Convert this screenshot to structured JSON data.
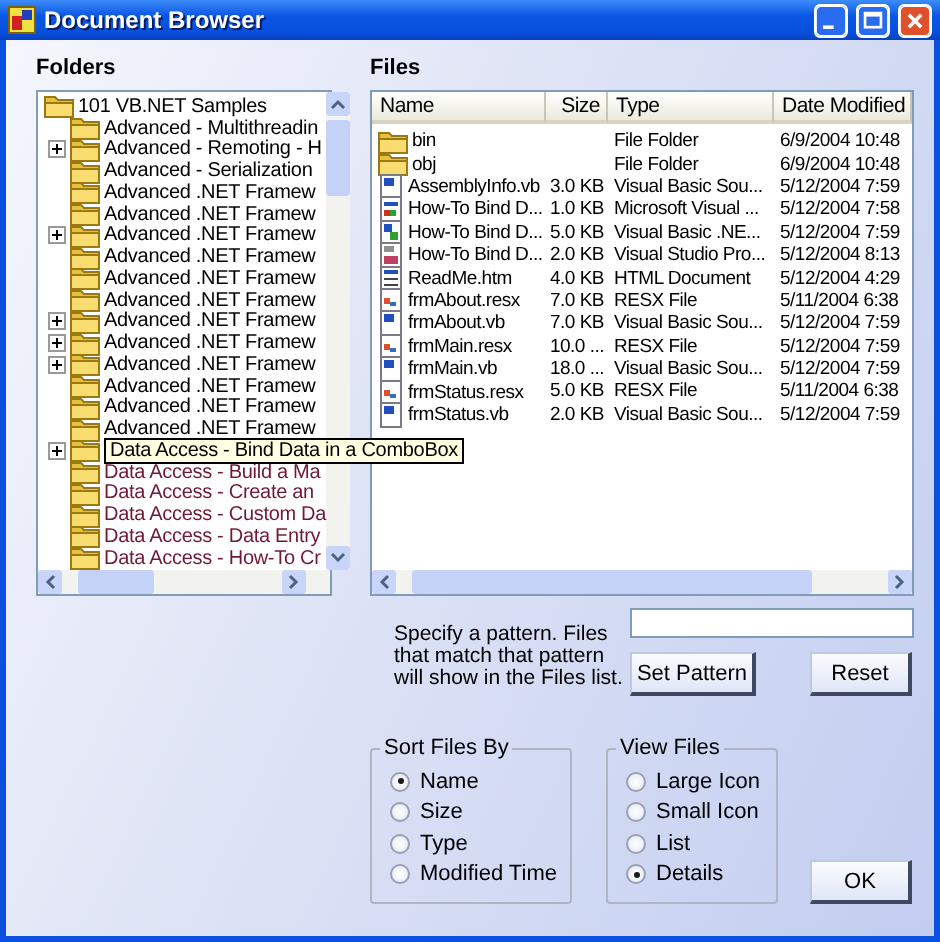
{
  "window": {
    "title": "Document Browser"
  },
  "folders": {
    "label": "Folders",
    "tree": {
      "label": "101 VB.NET Samples",
      "children": [
        {
          "label": "Advanced - Multithreadin",
          "expandable": false,
          "color": "#000000"
        },
        {
          "label": "Advanced - Remoting - H",
          "expandable": true,
          "color": "#000000"
        },
        {
          "label": "Advanced - Serialization",
          "expandable": false,
          "color": "#000000"
        },
        {
          "label": "Advanced .NET Framew",
          "expandable": false,
          "color": "#000000"
        },
        {
          "label": "Advanced .NET Framew",
          "expandable": false,
          "color": "#000000"
        },
        {
          "label": "Advanced .NET Framew",
          "expandable": true,
          "color": "#000000"
        },
        {
          "label": "Advanced .NET Framew",
          "expandable": false,
          "color": "#000000"
        },
        {
          "label": "Advanced .NET Framew",
          "expandable": false,
          "color": "#000000"
        },
        {
          "label": "Advanced .NET Framew",
          "expandable": false,
          "color": "#000000"
        },
        {
          "label": "Advanced .NET Framew",
          "expandable": true,
          "color": "#000000"
        },
        {
          "label": "Advanced .NET Framew",
          "expandable": true,
          "color": "#000000"
        },
        {
          "label": "Advanced .NET Framew",
          "expandable": true,
          "color": "#000000"
        },
        {
          "label": "Advanced .NET Framew",
          "expandable": false,
          "color": "#000000"
        },
        {
          "label": "Advanced .NET Framew",
          "expandable": false,
          "color": "#000000"
        },
        {
          "label": "Advanced .NET Framew",
          "expandable": false,
          "color": "#000000"
        },
        {
          "label": "Data Access - Bind Data in a ComboBox",
          "expandable": true,
          "hovered": true,
          "color": "#000000"
        },
        {
          "label": "Data Access - Build a Ma",
          "expandable": false,
          "color": "#701838"
        },
        {
          "label": "Data Access - Create an",
          "expandable": false,
          "color": "#701838"
        },
        {
          "label": "Data Access - Custom Da",
          "expandable": false,
          "color": "#701838"
        },
        {
          "label": "Data Access - Data Entry",
          "expandable": false,
          "color": "#701838"
        },
        {
          "label": "Data Access - How-To Cr",
          "expandable": false,
          "color": "#701838"
        }
      ]
    }
  },
  "files": {
    "label": "Files",
    "columns": [
      "Name",
      "Size",
      "Type",
      "Date Modified"
    ],
    "rows": [
      {
        "kind": "folder",
        "name": "bin",
        "type": "File Folder",
        "date": "6/9/2004 10:48"
      },
      {
        "kind": "folder",
        "name": "obj",
        "type": "File Folder",
        "date": "6/9/2004 10:48"
      },
      {
        "kind": "vb",
        "name": "AssemblyInfo.vb",
        "size": "3.0 KB",
        "type": "Visual Basic Sou...",
        "date": "5/12/2004 7:59"
      },
      {
        "kind": "solution",
        "name": "How-To Bind D...",
        "size": "1.0 KB",
        "type": "Microsoft Visual ...",
        "date": "5/12/2004 7:58"
      },
      {
        "kind": "project",
        "name": "How-To Bind D...",
        "size": "5.0 KB",
        "type": "Visual Basic .NE...",
        "date": "5/12/2004 7:59"
      },
      {
        "kind": "studio",
        "name": "How-To Bind D...",
        "size": "2.0 KB",
        "type": "Visual Studio Pro...",
        "date": "5/12/2004 8:13"
      },
      {
        "kind": "html",
        "name": "ReadMe.htm",
        "size": "4.0 KB",
        "type": "HTML Document",
        "date": "5/12/2004 4:29"
      },
      {
        "kind": "resx",
        "name": "frmAbout.resx",
        "size": "7.0 KB",
        "type": "RESX File",
        "date": "5/11/2004 6:38"
      },
      {
        "kind": "vb",
        "name": "frmAbout.vb",
        "size": "7.0 KB",
        "type": "Visual Basic Sou...",
        "date": "5/12/2004 7:59"
      },
      {
        "kind": "resx",
        "name": "frmMain.resx",
        "size": "10.0 ...",
        "type": "RESX File",
        "date": "5/12/2004 7:59"
      },
      {
        "kind": "vb",
        "name": "frmMain.vb",
        "size": "18.0 ...",
        "type": "Visual Basic Sou...",
        "date": "5/12/2004 7:59"
      },
      {
        "kind": "resx",
        "name": "frmStatus.resx",
        "size": "5.0 KB",
        "type": "RESX File",
        "date": "5/11/2004 6:38"
      },
      {
        "kind": "vb",
        "name": "frmStatus.vb",
        "size": "2.0 KB",
        "type": "Visual Basic Sou...",
        "date": "5/12/2004 7:59"
      }
    ]
  },
  "pattern": {
    "hint": "Specify a pattern. Files that match that pattern will show in the Files list.",
    "buttons": [
      "Set Pattern",
      "Reset"
    ]
  },
  "sort": {
    "title": "Sort Files By",
    "options": [
      {
        "label": "Name",
        "selected": true
      },
      {
        "label": "Size",
        "selected": false
      },
      {
        "label": "Type",
        "selected": false
      },
      {
        "label": "Modified Time",
        "selected": false
      }
    ]
  },
  "view": {
    "title": "View Files",
    "options": [
      {
        "label": "Large Icon",
        "selected": false
      },
      {
        "label": "Small Icon",
        "selected": false
      },
      {
        "label": "List",
        "selected": false
      },
      {
        "label": "Details",
        "selected": true
      }
    ]
  },
  "ok": "OK"
}
